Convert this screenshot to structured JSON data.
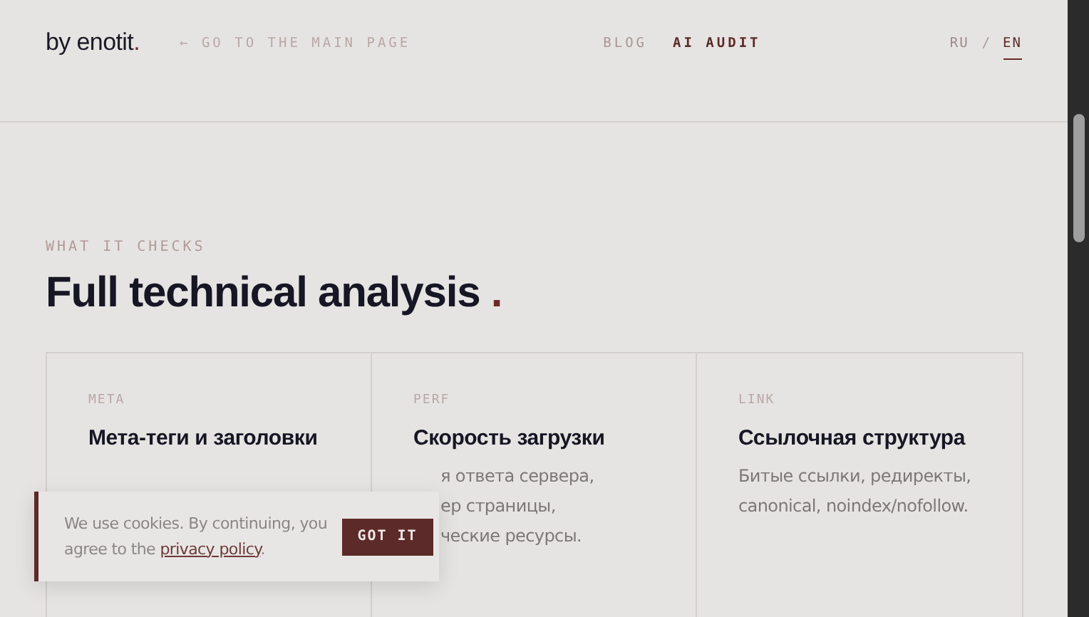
{
  "header": {
    "logo": "by enotit",
    "logo_dot": ".",
    "back_link": "← GO TO THE MAIN PAGE",
    "nav": [
      {
        "label": "BLOG",
        "selected": false
      },
      {
        "label": "AI AUDIT",
        "selected": true
      }
    ],
    "languages": [
      {
        "label": "RU",
        "selected": false
      },
      {
        "label": "EN",
        "selected": true
      }
    ],
    "lang_separator": "/"
  },
  "section": {
    "eyebrow": "WHAT IT CHECKS",
    "title": "Full technical analysis",
    "title_dot": "."
  },
  "cards": [
    {
      "tag": "META",
      "title": "Мета-теги и заголовки"
    },
    {
      "tag": "PERF",
      "title": "Скорость загрузки",
      "lines": [
        "я ответа сервера,",
        "ер страницы,",
        "ческие ресурсы."
      ]
    },
    {
      "tag": "LINK",
      "title": "Ссылочная структура",
      "lines": [
        "Битые ссылки, редиректы,",
        "canonical, noindex/nofollow."
      ]
    }
  ],
  "cookie_banner": {
    "text_before": "We use cookies. By continuing, you agree to the ",
    "link": "privacy policy",
    "text_after": ".",
    "button": "GOT IT"
  }
}
